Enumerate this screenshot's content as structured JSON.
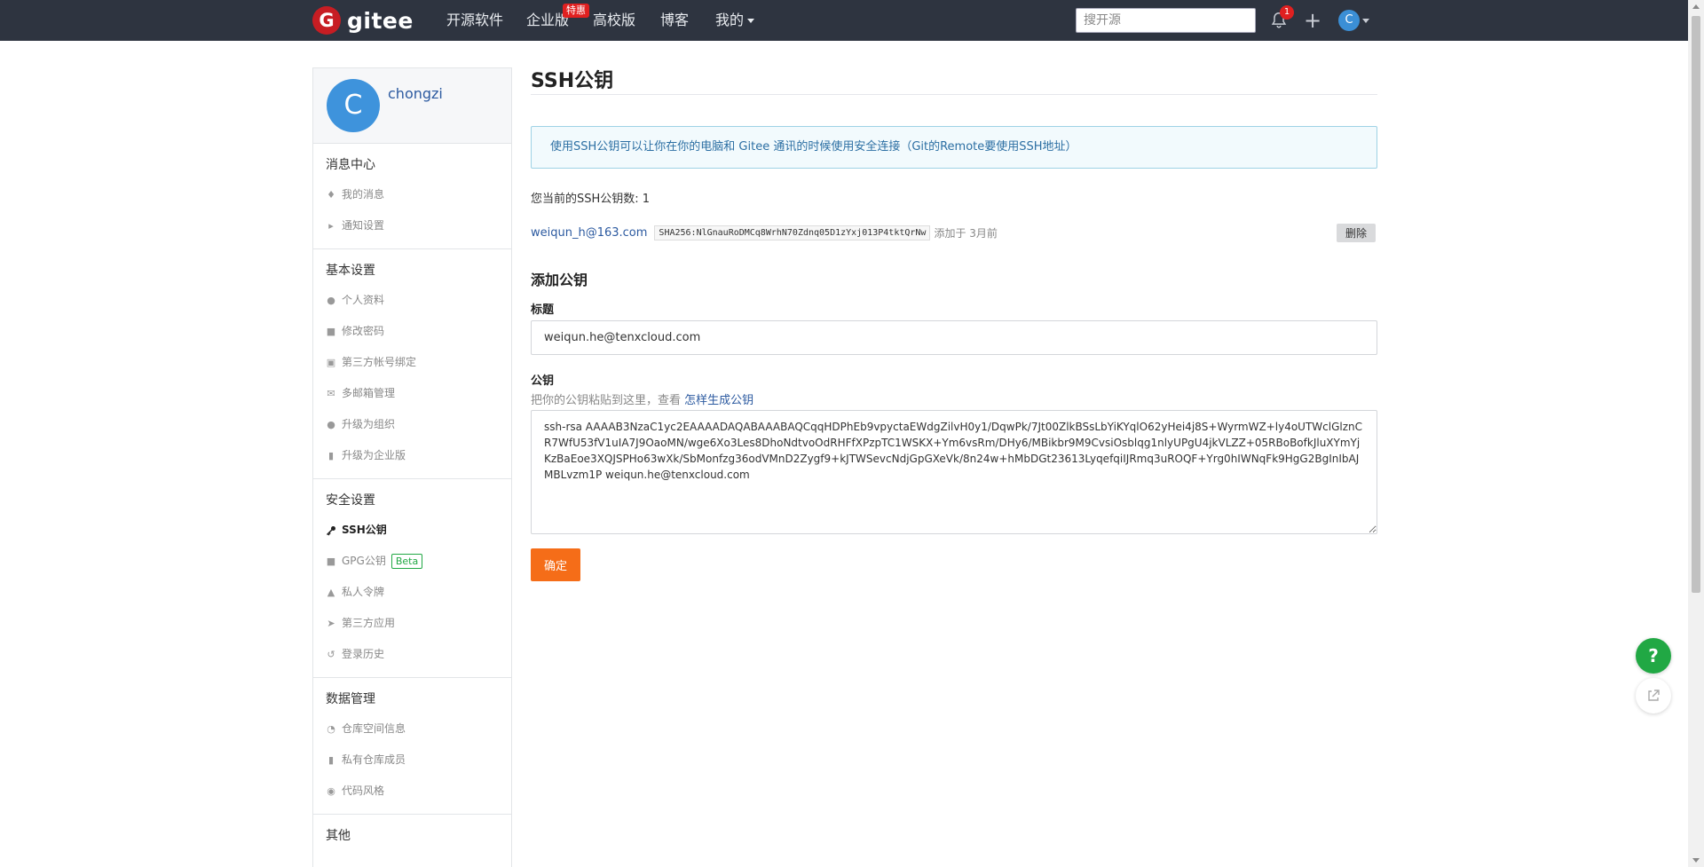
{
  "nav": {
    "logo_letter": "G",
    "logo_text": "gitee",
    "items": [
      "开源软件",
      "企业版",
      "高校版",
      "博客",
      "我的"
    ],
    "badge": "特惠",
    "search_placeholder": "搜开源",
    "notification_count": "1",
    "avatar_letter": "C"
  },
  "sidebar": {
    "profile": {
      "avatar_letter": "C",
      "username": "chongzi"
    },
    "sections": [
      {
        "title": "消息中心",
        "items": [
          {
            "icon": "bell-icon",
            "label": "我的消息"
          },
          {
            "icon": "megaphone-icon",
            "label": "通知设置"
          }
        ]
      },
      {
        "title": "基本设置",
        "items": [
          {
            "icon": "user-icon",
            "label": "个人资料"
          },
          {
            "icon": "lock-open-icon",
            "label": "修改密码"
          },
          {
            "icon": "id-card-icon",
            "label": "第三方帐号绑定"
          },
          {
            "icon": "mail-icon",
            "label": "多邮箱管理"
          },
          {
            "icon": "users-icon",
            "label": "升级为组织"
          },
          {
            "icon": "building-icon",
            "label": "升级为企业版"
          }
        ]
      },
      {
        "title": "安全设置",
        "items": [
          {
            "icon": "key-icon",
            "label": "SSH公钥",
            "active": true
          },
          {
            "icon": "lock-icon",
            "label": "GPG公钥",
            "badge": "Beta"
          },
          {
            "icon": "token-icon",
            "label": "私人令牌"
          },
          {
            "icon": "rocket-icon",
            "label": "第三方应用"
          },
          {
            "icon": "history-icon",
            "label": "登录历史"
          }
        ]
      },
      {
        "title": "数据管理",
        "items": [
          {
            "icon": "pie-chart-icon",
            "label": "仓库空间信息"
          },
          {
            "icon": "book-icon",
            "label": "私有仓库成员"
          },
          {
            "icon": "palette-icon",
            "label": "代码风格"
          }
        ]
      },
      {
        "title": "其他",
        "items": []
      }
    ]
  },
  "main": {
    "title": "SSH公钥",
    "info": "使用SSH公钥可以让你在你的电脑和 Gitee 通讯的时候使用安全连接（Git的Remote要使用SSH地址）",
    "key_count": "您当前的SSH公钥数: 1",
    "key": {
      "email": "weiqun_h@163.com",
      "fingerprint": "SHA256:NlGnauRoDMCq8WrhN70Zdnq05D1zYxj013P4tktQrNw",
      "added": "添加于 3月前",
      "delete_label": "删除"
    },
    "add_heading": "添加公钥",
    "title_label": "标题",
    "title_value": "weiqun.he@tenxcloud.com",
    "pubkey_label": "公钥",
    "hint_text": "把你的公钥粘贴到这里，查看 ",
    "hint_link": "怎样生成公钥",
    "pubkey_value": "ssh-rsa AAAAB3NzaC1yc2EAAAADAQABAAABAQCqqHDPhEb9vpyctaEWdgZilvH0y1/DqwPk/7Jt00ZlkBSsLbYiKYqlO62yHei4j8S+WyrmWZ+ly4oUTWclGlznCR7WfU53fV1uIA7J9OaoMN/wge6Xo3Les8DhoNdtvoOdRHFfXPzpTC1WSKX+Ym6vsRm/DHy6/MBikbr9M9CvsiOsblqg1nlyUPgU4jkVLZZ+05RBoBofkJluXYmYjKzBaEoe3XQJSPHo63wXk/SbMonfzg36odVMnD2Zygf9+kJTWSevcNdjGpGXeVk/8n24w+hMbDGt23613LyqefqiIJRmq3uROQF+Yrg0hIWNqFk9HgG2BgInIbAJMBLvzm1P weiqun.he@tenxcloud.com",
    "confirm_label": "确定"
  },
  "floating": {
    "help": "?"
  },
  "colors": {
    "nav_bg": "#2e3440",
    "accent": "#f56d18",
    "link": "#2c5aa0",
    "help": "#21a844"
  }
}
